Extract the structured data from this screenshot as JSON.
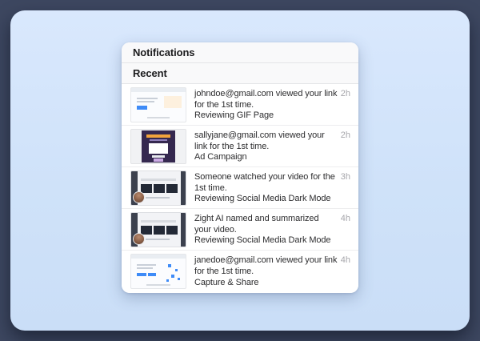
{
  "colors": {
    "background": "#3d4760",
    "card_top": "#d9e8fd",
    "card_bottom": "#cadef7",
    "panel": "#ffffff",
    "header_bg": "#f9f9fa",
    "separator": "#ededef",
    "text_primary": "#2c2c2e",
    "timestamp": "#a6a6ab",
    "accent_blue": "#3e8bf7",
    "accent_orange": "#f6a43a",
    "thumb_purple": "#35284f"
  },
  "panel": {
    "title": "Notifications",
    "section": "Recent",
    "items": [
      {
        "message": "johndoe@gmail.com viewed your link for the 1st time.",
        "title": "Reviewing GIF Page",
        "time": "2h",
        "thumb": "gif-page"
      },
      {
        "message": "sallyjane@gmail.com viewed your link for the 1st time.",
        "title": "Ad Campaign",
        "time": "2h",
        "thumb": "ad-campaign"
      },
      {
        "message": "Someone watched your video for the 1st time.",
        "title": "Reviewing Social Media Dark Mode",
        "time": "3h",
        "thumb": "video-dark"
      },
      {
        "message": "Zight AI named and summarized your video.",
        "title": "Reviewing Social Media Dark Mode",
        "time": "4h",
        "thumb": "video-dark"
      },
      {
        "message": "janedoe@gmail.com viewed your link for the 1st time.",
        "time": "4h",
        "title": "Capture & Share",
        "thumb": "capture-share"
      }
    ]
  }
}
